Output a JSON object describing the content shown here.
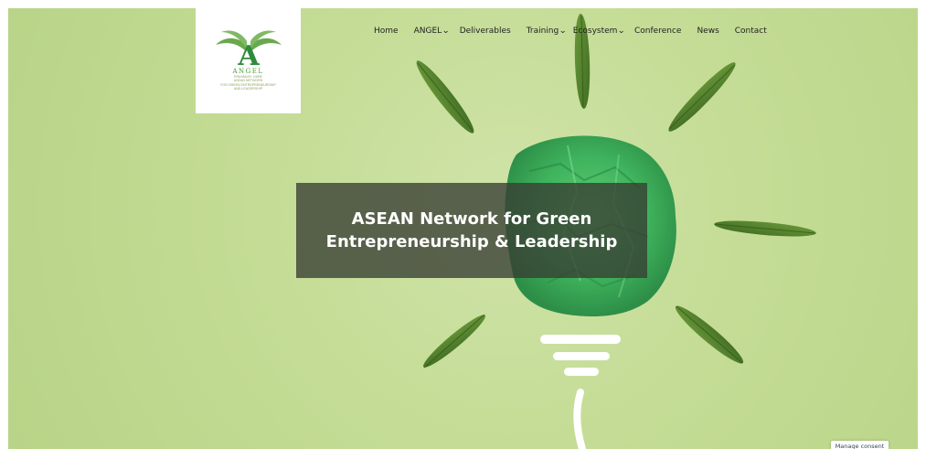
{
  "nav": {
    "items": [
      {
        "label": "Home",
        "has_dropdown": false
      },
      {
        "label": "ANGEL",
        "has_dropdown": true
      },
      {
        "label": "Deliverables",
        "has_dropdown": false
      },
      {
        "label": "Training",
        "has_dropdown": true
      },
      {
        "label": "Ecosystem",
        "has_dropdown": true
      },
      {
        "label": "Conference",
        "has_dropdown": false
      },
      {
        "label": "News",
        "has_dropdown": false
      },
      {
        "label": "Contact",
        "has_dropdown": false
      }
    ],
    "chevron_icon": "chevron-down-icon"
  },
  "logo": {
    "letter": "A",
    "name": "ANGEL",
    "lines": [
      "ERASMUS+ CBHE",
      "ASEAN NETWORK",
      "FOR GREEN ENTREPRENEURSHIP",
      "AND LEADERSHIP"
    ],
    "icon": "wings-logo-icon",
    "color": "#4d9a38"
  },
  "hero": {
    "title_line1": "ASEAN Network for Green",
    "title_line2": "Entrepreneurship & Leadership",
    "image": "crumpled-paper-lightbulb-leaves",
    "background_color": "#c4dc95"
  },
  "consent": {
    "label": "Manage consent"
  }
}
